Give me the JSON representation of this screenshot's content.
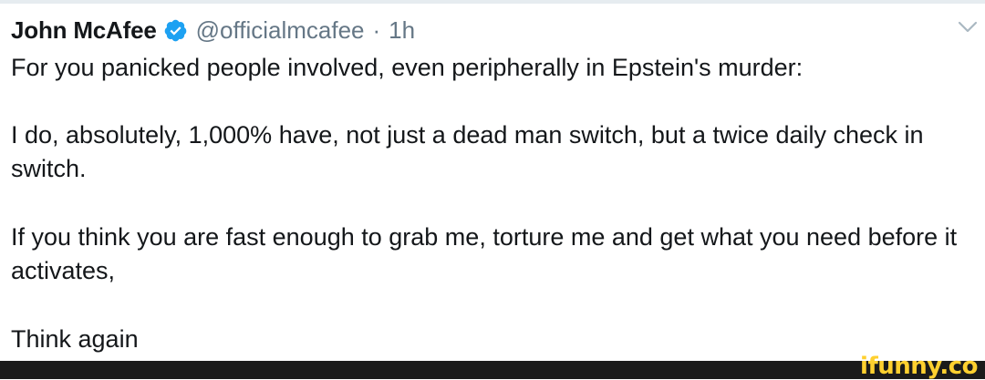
{
  "tweet": {
    "display_name": "John McAfee",
    "handle": "@officialmcafee",
    "separator": "·",
    "timestamp": "1h",
    "paragraphs": [
      "For you panicked people involved, even peripherally in Epstein's murder:",
      "I do, absolutely, 1,000% have, not just a dead man switch, but a twice daily check in switch.",
      "If you think you are fast enough to grab me, torture me and get what you need before it activates,",
      "Think again"
    ],
    "icons": {
      "verified": "verified-badge-icon",
      "menu": "chevron-down-icon"
    },
    "colors": {
      "verified_blue": "#1da1f2",
      "text": "#14171a",
      "muted": "#657786"
    }
  },
  "watermark": {
    "text": "ifunny.co",
    "color": "#ffd02f"
  }
}
